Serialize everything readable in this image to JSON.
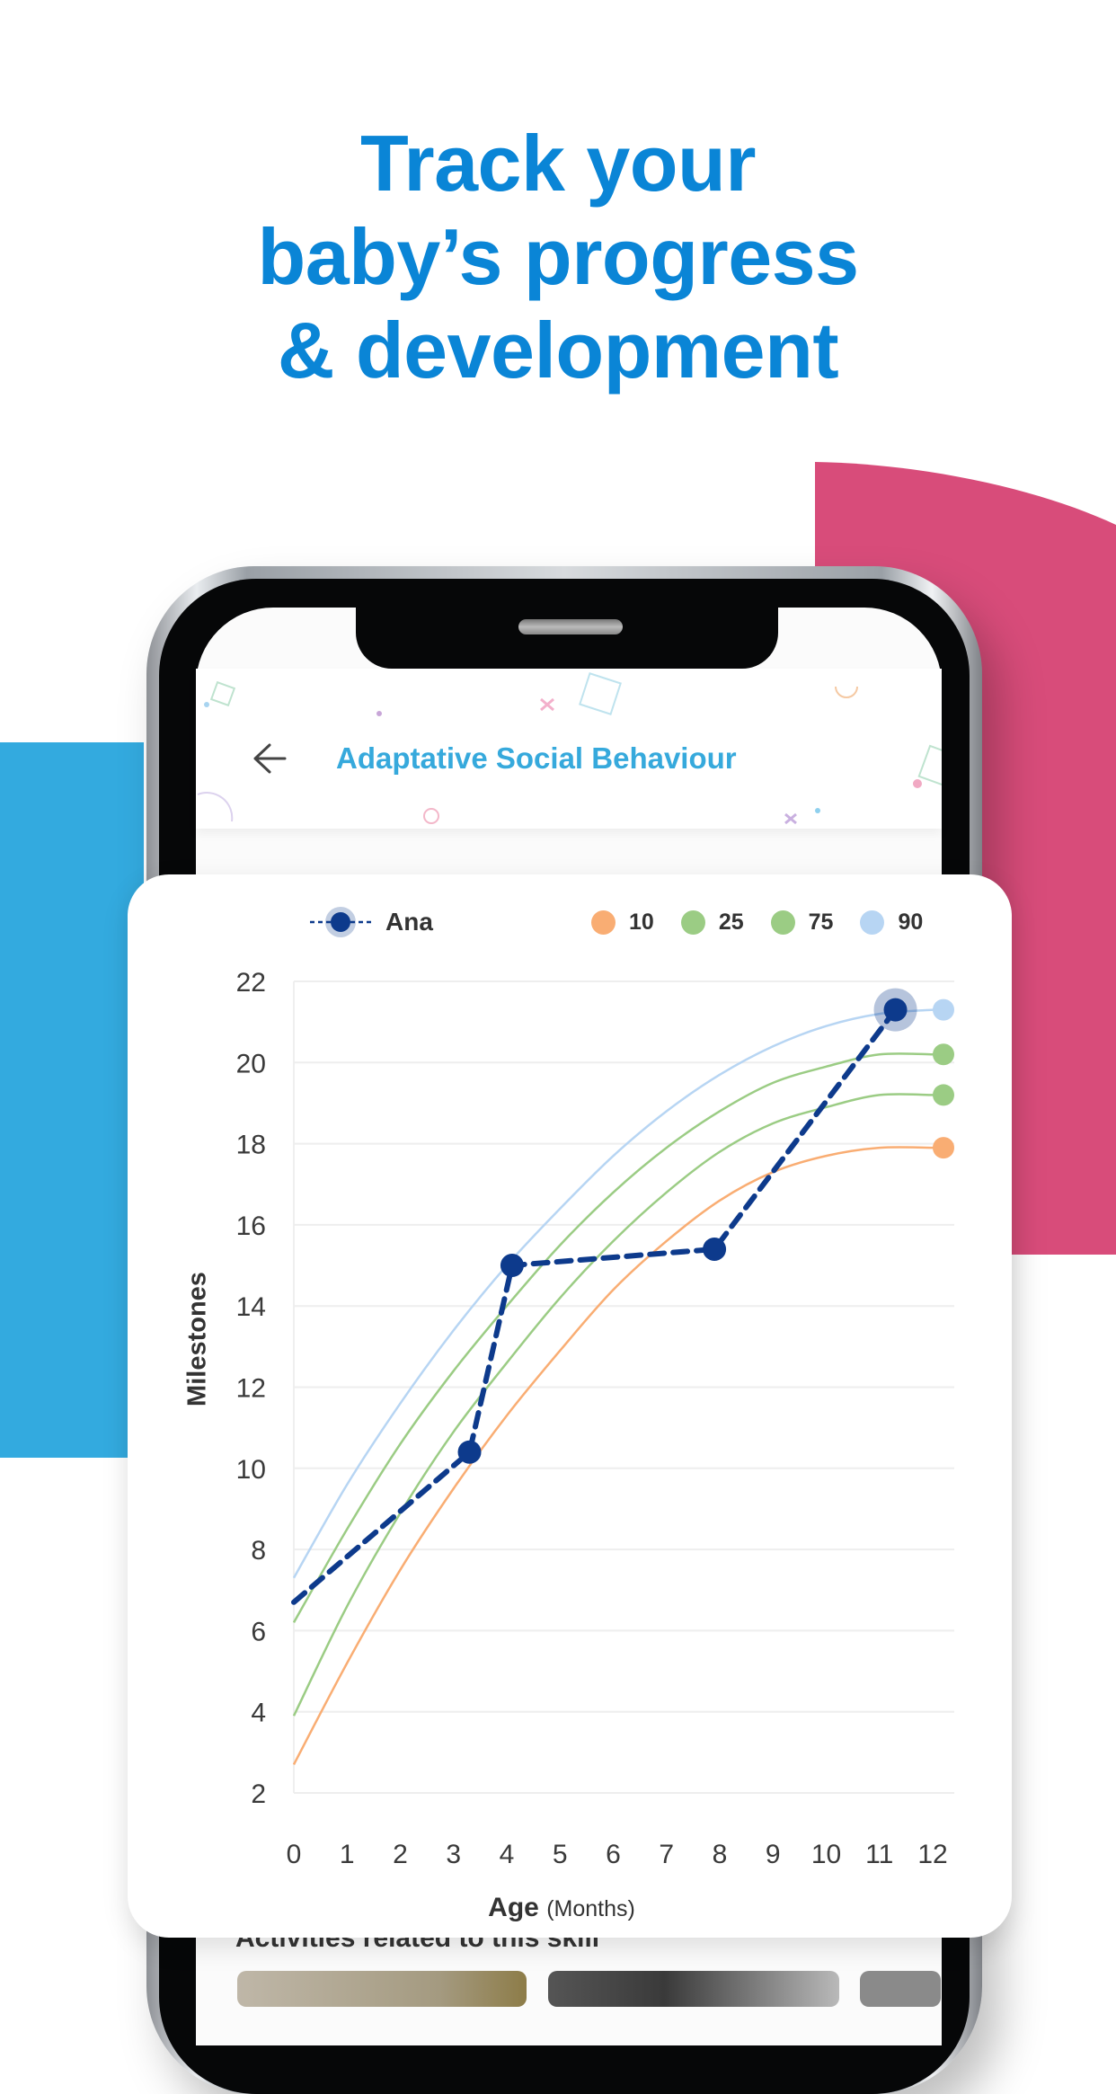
{
  "headline": {
    "lines": [
      "Track your",
      "baby’s progress",
      "& development"
    ],
    "color": "#0a85d6"
  },
  "decor": {
    "blue_block_color": "#33aadf",
    "pink_block_color": "#d84c7a"
  },
  "app": {
    "back_icon": "arrow-left-icon",
    "title": "Adaptative Social Behaviour",
    "title_color": "#36a9dc",
    "below_card_text": "Activities related to this skill"
  },
  "chart_data": {
    "type": "line",
    "title": "",
    "xlabel": "Age",
    "xlabel_unit": "(Months)",
    "ylabel": "Milestones",
    "xlim": [
      0,
      12
    ],
    "ylim": [
      2,
      22
    ],
    "x_ticks": [
      0,
      1,
      2,
      3,
      4,
      5,
      6,
      7,
      8,
      9,
      10,
      11,
      12
    ],
    "y_ticks": [
      2,
      4,
      6,
      8,
      10,
      12,
      14,
      16,
      18,
      20,
      22
    ],
    "grid": true,
    "legend": {
      "placement": "top",
      "child": {
        "name": "Ana",
        "color": "#0d3a8c"
      },
      "percentiles": [
        {
          "name": "10",
          "color": "#f9ad73"
        },
        {
          "name": "25",
          "color": "#9bcc84"
        },
        {
          "name": "75",
          "color": "#9bcc84"
        },
        {
          "name": "90",
          "color": "#b7d5f3"
        }
      ]
    },
    "series": [
      {
        "name": "Ana",
        "style": "dashed-with-markers",
        "color": "#0d3a8c",
        "x": [
          0,
          3.3,
          4.1,
          7.9,
          11.3
        ],
        "y": [
          6.7,
          10.4,
          15.0,
          15.4,
          21.3
        ],
        "highlighted_point_index": 4
      },
      {
        "name": "90",
        "color": "#b7d5f3",
        "x": [
          0,
          1,
          2,
          3,
          4,
          5,
          6,
          7,
          8,
          9,
          10,
          11,
          12
        ],
        "y": [
          7.3,
          9.6,
          11.6,
          13.4,
          15.0,
          16.4,
          17.7,
          18.8,
          19.7,
          20.4,
          20.9,
          21.2,
          21.3
        ]
      },
      {
        "name": "75",
        "color": "#9bcc84",
        "x": [
          0,
          1,
          2,
          3,
          4,
          5,
          6,
          7,
          8,
          9,
          10,
          11,
          12
        ],
        "y": [
          6.2,
          8.5,
          10.6,
          12.4,
          14.0,
          15.5,
          16.8,
          17.9,
          18.8,
          19.5,
          19.9,
          20.2,
          20.2
        ]
      },
      {
        "name": "25",
        "color": "#9bcc84",
        "x": [
          0,
          1,
          2,
          3,
          4,
          5,
          6,
          7,
          8,
          9,
          10,
          11,
          12
        ],
        "y": [
          3.9,
          6.6,
          8.9,
          10.9,
          12.6,
          14.2,
          15.6,
          16.8,
          17.8,
          18.5,
          18.9,
          19.2,
          19.2
        ]
      },
      {
        "name": "10",
        "color": "#f9ad73",
        "x": [
          0,
          1,
          2,
          3,
          4,
          5,
          6,
          7,
          8,
          9,
          10,
          11,
          12
        ],
        "y": [
          2.7,
          5.2,
          7.5,
          9.5,
          11.3,
          12.9,
          14.4,
          15.6,
          16.6,
          17.3,
          17.7,
          17.9,
          17.9
        ]
      }
    ]
  }
}
